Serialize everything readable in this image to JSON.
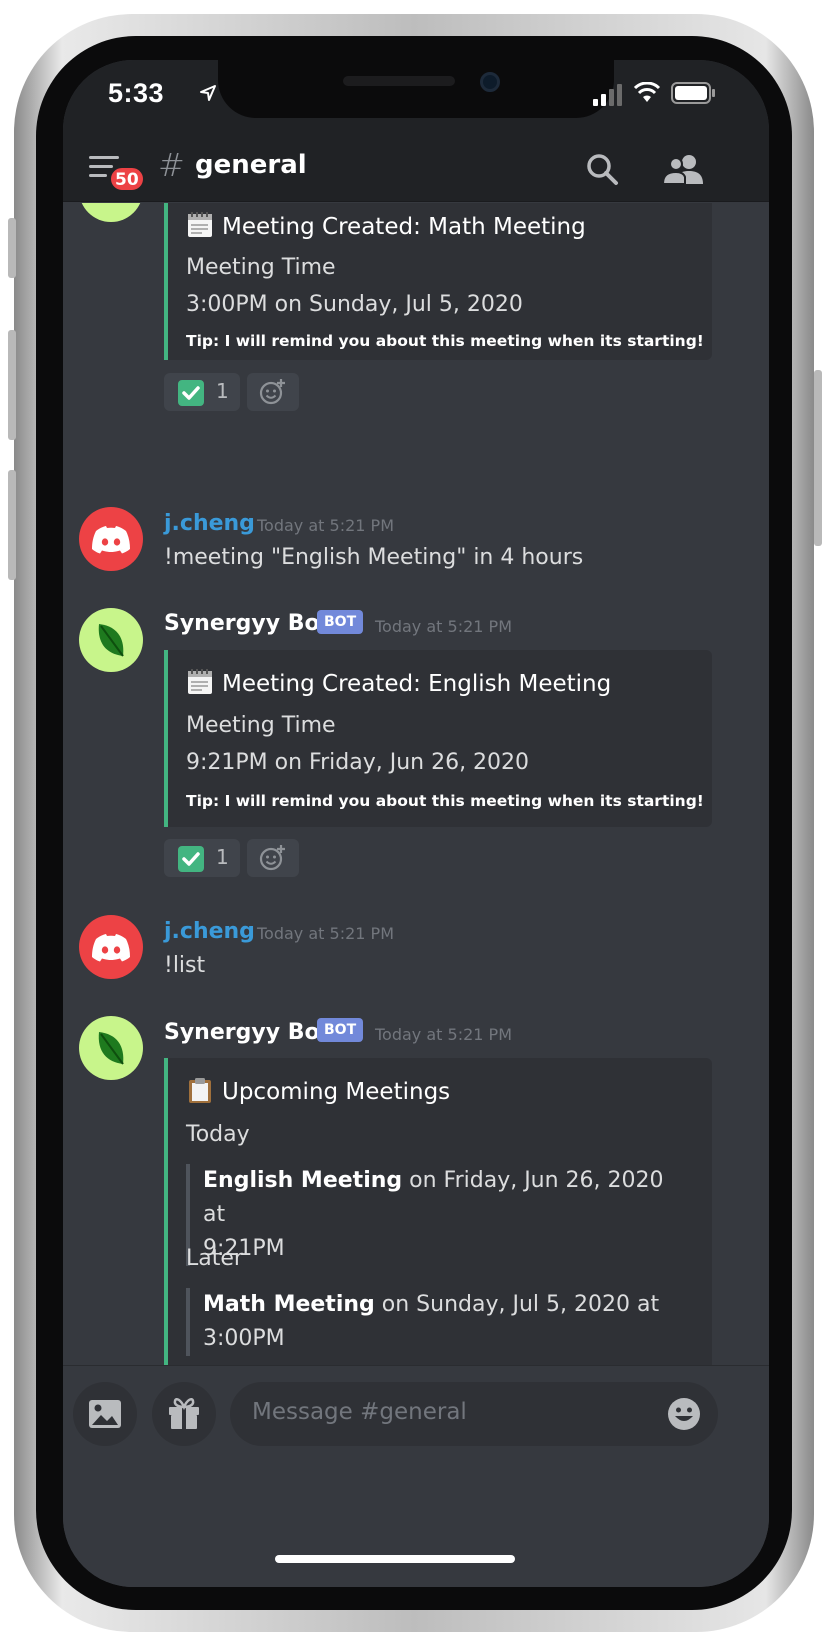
{
  "status_bar": {
    "time": "5:33"
  },
  "header": {
    "channel_hash": "#",
    "channel_name": "general",
    "badge_count": "50"
  },
  "messages": [
    {
      "type": "embed-partial",
      "embed": {
        "title": "Meeting Created: Math Meeting",
        "field_name": "Meeting Time",
        "field_value": "3:00PM on Sunday, Jul 5, 2020",
        "tip": "Tip: I will remind you about this meeting when its starting!"
      },
      "reaction": {
        "emoji": "check-mark",
        "count": "1"
      }
    },
    {
      "author": "j.cheng",
      "timestamp": "Today at 5:21 PM",
      "text": "!meeting \"English Meeting\" in 4 hours"
    },
    {
      "author": "Synergyy Bot",
      "bot_tag": "BOT",
      "timestamp": "Today at 5:21 PM",
      "embed": {
        "title": "Meeting Created: English Meeting",
        "field_name": "Meeting Time",
        "field_value": "9:21PM on Friday, Jun 26, 2020",
        "tip": "Tip: I will remind you about this meeting when its starting!"
      },
      "reaction": {
        "emoji": "check-mark",
        "count": "1"
      }
    },
    {
      "author": "j.cheng",
      "timestamp": "Today at 5:21 PM",
      "text": "!list"
    },
    {
      "author": "Synergyy Bot",
      "bot_tag": "BOT",
      "timestamp": "Today at 5:21 PM",
      "embed": {
        "title": "Upcoming Meetings",
        "section1_label": "Today",
        "section1_name": "English Meeting",
        "section1_rest": " on Friday, Jun 26, 2020 at",
        "section1_time": "9:21PM",
        "section2_label": "Later",
        "section2_name": "Math Meeting",
        "section2_rest": " on Sunday, Jul 5, 2020 at",
        "section2_time": "3:00PM"
      }
    }
  ],
  "composer": {
    "placeholder": "Message #general"
  },
  "colors": {
    "background": "#36393f",
    "header": "#202225",
    "embed": "#2f3136",
    "embed_accent": "#43b581",
    "user_name": "#3a9ad9",
    "bot_tag": "#7289da",
    "badge": "#ed4245"
  },
  "icons": [
    "location-arrow-icon",
    "signal-icon",
    "wifi-icon",
    "battery-icon",
    "hamburger-menu-icon",
    "search-icon",
    "members-icon",
    "image-icon",
    "gift-icon",
    "emoji-icon",
    "add-reaction-icon",
    "calendar-emoji-icon",
    "clipboard-emoji-icon",
    "discord-logo-icon",
    "leaf-icon"
  ]
}
